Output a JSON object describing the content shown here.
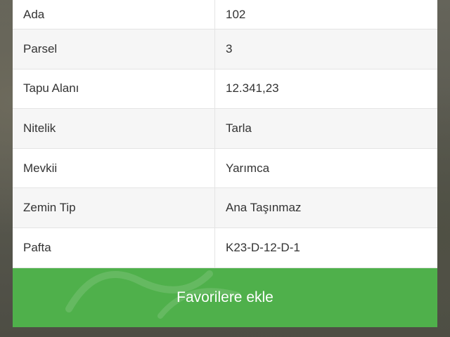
{
  "details": {
    "rows": [
      {
        "label": "Ada",
        "value": "102"
      },
      {
        "label": "Parsel",
        "value": "3"
      },
      {
        "label": "Tapu Alanı",
        "value": "12.341,23"
      },
      {
        "label": "Nitelik",
        "value": "Tarla"
      },
      {
        "label": "Mevkii",
        "value": "Yarımca"
      },
      {
        "label": "Zemin Tip",
        "value": "Ana Taşınmaz"
      },
      {
        "label": "Pafta",
        "value": "K23-D-12-D-1"
      }
    ]
  },
  "actions": {
    "favorite_label": "Favorilere ekle"
  },
  "colors": {
    "accent": "#4fb04b",
    "backdrop": "#5b5a50"
  }
}
